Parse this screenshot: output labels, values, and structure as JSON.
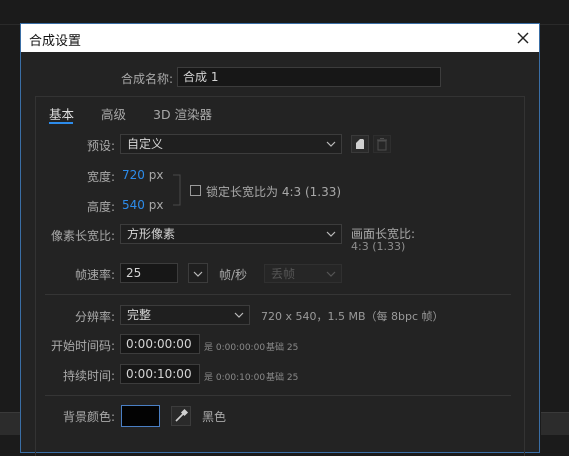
{
  "dialog": {
    "title": "合成设置",
    "comp_name_label": "合成名称:",
    "comp_name_value": "合成 1"
  },
  "tabs": [
    {
      "label": "基本",
      "active": true
    },
    {
      "label": "高级",
      "active": false
    },
    {
      "label": "3D 渲染器",
      "active": false
    }
  ],
  "preset": {
    "label": "预设:",
    "value": "自定义"
  },
  "width": {
    "label": "宽度:",
    "value": "720",
    "unit": "px"
  },
  "height": {
    "label": "高度:",
    "value": "540",
    "unit": "px"
  },
  "lock_aspect": {
    "label": "锁定长宽比为 4:3 (1.33)",
    "checked": false
  },
  "pixel_aspect": {
    "label": "像素长宽比:",
    "value": "方形像素"
  },
  "frame_aspect": {
    "label": "画面长宽比:",
    "value": "4:3 (1.33)"
  },
  "frame_rate": {
    "label": "帧速率:",
    "value": "25",
    "unit": "帧/秒",
    "drop_frame": "丢帧"
  },
  "resolution": {
    "label": "分辨率:",
    "value": "完整",
    "info": "720 x 540，1.5 MB（每 8bpc 帧）"
  },
  "start_timecode": {
    "label": "开始时间码:",
    "value": "0:00:00:00",
    "note_eq": "是 0:00:00:00",
    "note_base": "基础 25"
  },
  "duration": {
    "label": "持续时间:",
    "value": "0:00:10:00",
    "note_eq": "是 0:00:10:00",
    "note_base": "基础 25"
  },
  "background": {
    "label": "背景颜色:",
    "color": "#030303",
    "color_name": "黑色"
  },
  "colors": {
    "accent": "#2d8ceb",
    "dialog_bg": "#232323",
    "title_bg": "#ffffff"
  }
}
